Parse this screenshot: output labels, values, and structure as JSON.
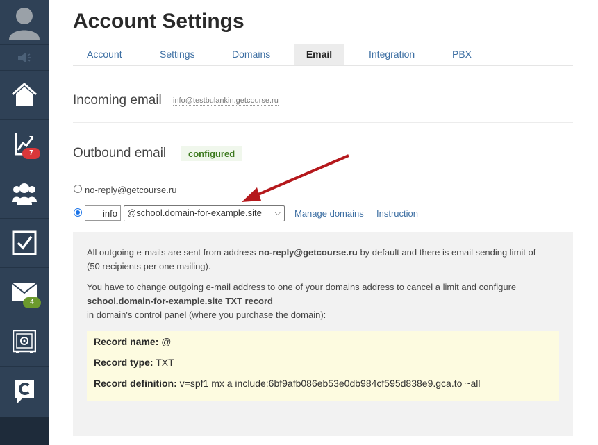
{
  "sidebar": {
    "items": [
      {
        "name": "avatar",
        "icon": "user-avatar-icon"
      },
      {
        "name": "sound",
        "icon": "speaker-icon"
      },
      {
        "name": "home",
        "icon": "home-icon"
      },
      {
        "name": "stats",
        "icon": "chart-icon",
        "badge": "7",
        "badge_color": "#d9373a"
      },
      {
        "name": "users",
        "icon": "users-icon"
      },
      {
        "name": "tasks",
        "icon": "checkbox-icon"
      },
      {
        "name": "messages",
        "icon": "envelope-icon",
        "badge": "4",
        "badge_color": "#6c9a2d"
      },
      {
        "name": "settings",
        "icon": "safe-icon"
      },
      {
        "name": "getcourse",
        "icon": "getcourse-logo-icon"
      }
    ]
  },
  "page": {
    "title": "Account Settings"
  },
  "tabs": [
    {
      "label": "Account"
    },
    {
      "label": "Settings"
    },
    {
      "label": "Domains"
    },
    {
      "label": "Email",
      "active": true
    },
    {
      "label": "Integration"
    },
    {
      "label": "PBX"
    }
  ],
  "incoming": {
    "title": "Incoming email",
    "address": "info@testbulankin.getcourse.ru"
  },
  "outbound": {
    "title": "Outbound email",
    "status": "configured",
    "option_default": "no-reply@getcourse.ru",
    "prefix_value": "info",
    "domain_selected": "@school.domain-for-example.site",
    "manage_domains": "Manage domains",
    "instruction": "Instruction"
  },
  "info": {
    "p1_a": "All outgoing e-mails are sent from address ",
    "p1_bold": "no-reply@getcourse.ru",
    "p1_b": " by default and there is email sending limit of",
    "p1_c": "(50 recipients per one mailing).",
    "p2_a": "You have to change outgoing e-mail address to one of your domains address to cancel a limit   and configure",
    "p2_bold": "school.domain-for-example.site TXT record",
    "p2_c": "in domain's control panel (where you purchase the domain):",
    "record_name_label": "Record name:",
    "record_name_value": " @",
    "record_type_label": "Record type:",
    "record_type_value": " TXT",
    "record_def_label": "Record definition:",
    "record_def_value": " v=spf1 mx a include:6bf9afb086eb53e0db984cf595d838e9.gca.to ~all"
  },
  "colors": {
    "sidebar_bg": "#2f4156",
    "link": "#3d6fa3",
    "configured_green": "#3d7a1f",
    "arrow_red": "#b5181c"
  }
}
